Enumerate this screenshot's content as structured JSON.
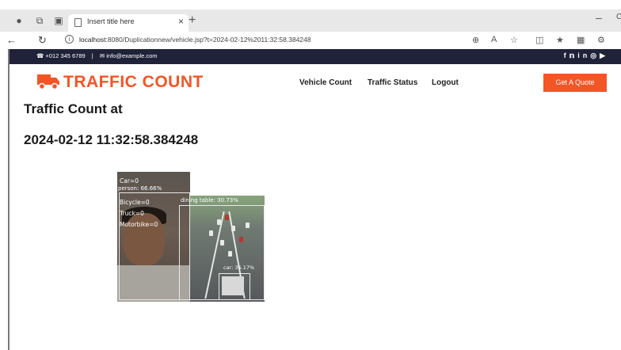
{
  "browser": {
    "tab_title": "Insert title here",
    "tab_close": "×",
    "new_tab": "+",
    "window_min": "–",
    "window_extra": "C",
    "url_host": "localhost",
    "url_rest": ":8080/Duplicationnew/vehicle.jsp?t=2024-02-12%2011:32:58.384248"
  },
  "topbar": {
    "phone": "+012 345 6789",
    "separator": "|",
    "email": "info@example.com",
    "social": [
      "f",
      "t",
      "in",
      "ig",
      "yt"
    ]
  },
  "navbar": {
    "logo_text": "TRAFFIC COUNT",
    "links": [
      "Vehicle Count",
      "Traffic Status",
      "Logout"
    ],
    "quote_button": "Get A Quote"
  },
  "page": {
    "title_line1": "Traffic Count at",
    "title_line2": "2024-02-12 11:32:58.384248"
  },
  "detection": {
    "labels": [
      "Car=0",
      "person: 66.66%",
      "Bicycle=0",
      "Truck=0",
      "Motorbike=0",
      "dining table: 30.73%",
      "car: 36.17%"
    ]
  },
  "colors": {
    "accent": "#f35525",
    "topbar_bg": "#1f2238"
  }
}
